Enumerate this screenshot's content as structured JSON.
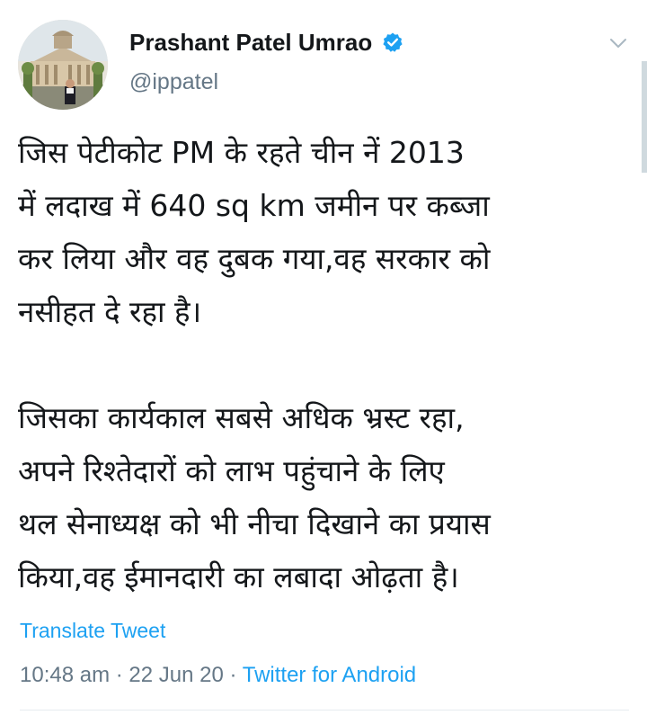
{
  "author": {
    "display_name": "Prashant Patel Umrao",
    "handle": "@ippatel",
    "verified_icon": "verified-badge-icon",
    "avatar_icon": "avatar-supreme-court-building"
  },
  "menu_icon": "chevron-down-icon",
  "tweet": {
    "lines": [
      "जिस पेटीकोट PM के रहते चीन नें 2013",
      "में लदाख में 640 sq km जमीन पर कब्जा",
      "कर लिया और वह दुबक गया,वह सरकार को",
      "नसीहत दे रहा है।",
      "जिसका कार्यकाल सबसे अधिक भ्रस्ट रहा,",
      "अपने रिश्तेदारों को लाभ पहुंचाने के लिए",
      "थल सेनाध्यक्ष को भी नीचा दिखाने का प्रयास",
      "किया,वह ईमानदारी का लबादा ओढ़ता है।"
    ]
  },
  "translate_label": "Translate Tweet",
  "meta": {
    "time": "10:48 am",
    "separator": " · ",
    "date": "22 Jun 20",
    "source": "Twitter for Android"
  },
  "colors": {
    "accent": "#1da1f2",
    "text": "#14171a",
    "secondary": "#657786"
  }
}
